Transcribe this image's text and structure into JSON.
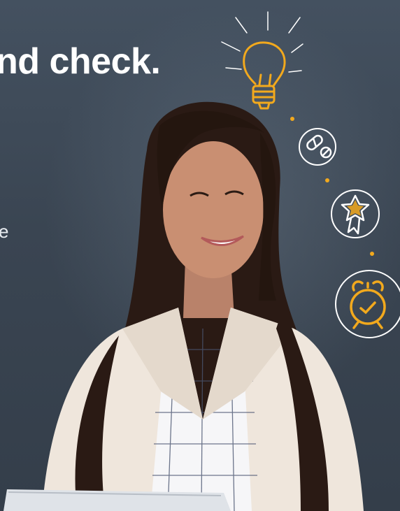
{
  "headline": "nd check.",
  "side_text": "e",
  "icons": [
    "lightbulb-icon",
    "pills-icon",
    "award-ribbon-icon",
    "alarm-clock-icon"
  ],
  "colors": {
    "background": "#3b4654",
    "accent": "#f2a91d",
    "headline": "#ffffff",
    "blazer": "#efe6dc",
    "hair": "#2a1a14",
    "skin": "#c98f72"
  }
}
